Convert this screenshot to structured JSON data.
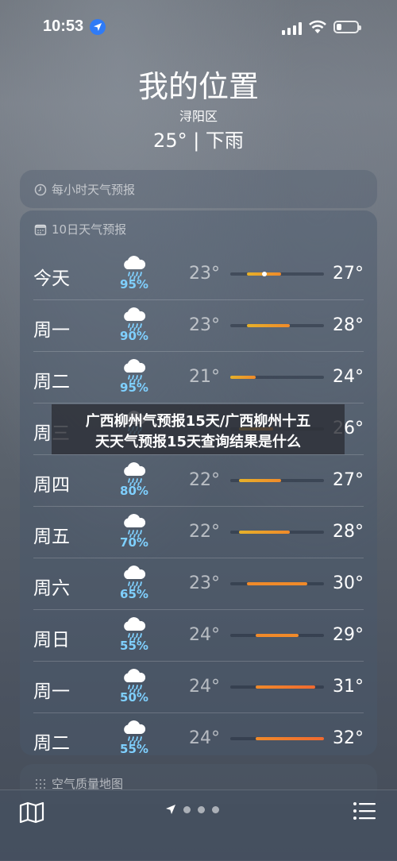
{
  "status_bar": {
    "time": "10:53",
    "icons": [
      "location-arrow-icon",
      "signal-icon",
      "wifi-icon",
      "battery-icon"
    ]
  },
  "header": {
    "title": "我的位置",
    "district": "浔阳区",
    "current": "25° | 下雨"
  },
  "hourly_panel": {
    "label": "每小时天气预报",
    "icon": "clock-icon"
  },
  "daily_panel": {
    "label": "10日天气预报",
    "icon": "calendar-icon",
    "range": [
      21,
      32
    ],
    "days": [
      {
        "day": "今天",
        "icon": "rain-cloud-icon",
        "pop": "95%",
        "low": "23°",
        "high": "27°",
        "lo": 23,
        "hi": 27,
        "current": 25
      },
      {
        "day": "周一",
        "icon": "rain-cloud-icon",
        "pop": "90%",
        "low": "23°",
        "high": "28°",
        "lo": 23,
        "hi": 28
      },
      {
        "day": "周二",
        "icon": "rain-cloud-icon",
        "pop": "95%",
        "low": "21°",
        "high": "24°",
        "lo": 21,
        "hi": 24
      },
      {
        "day": "周三",
        "icon": "rain-cloud-icon",
        "pop": "",
        "low": "",
        "high": "26°",
        "lo": 22,
        "hi": 26
      },
      {
        "day": "周四",
        "icon": "rain-cloud-icon",
        "pop": "80%",
        "low": "22°",
        "high": "27°",
        "lo": 22,
        "hi": 27
      },
      {
        "day": "周五",
        "icon": "rain-cloud-icon",
        "pop": "70%",
        "low": "22°",
        "high": "28°",
        "lo": 22,
        "hi": 28
      },
      {
        "day": "周六",
        "icon": "rain-cloud-icon",
        "pop": "65%",
        "low": "23°",
        "high": "30°",
        "lo": 23,
        "hi": 30
      },
      {
        "day": "周日",
        "icon": "rain-cloud-icon",
        "pop": "55%",
        "low": "24°",
        "high": "29°",
        "lo": 24,
        "hi": 29
      },
      {
        "day": "周一",
        "icon": "rain-cloud-icon",
        "pop": "50%",
        "low": "24°",
        "high": "31°",
        "lo": 24,
        "hi": 31
      },
      {
        "day": "周二",
        "icon": "rain-cloud-icon",
        "pop": "55%",
        "low": "24°",
        "high": "32°",
        "lo": 24,
        "hi": 32
      }
    ]
  },
  "air_quality_panel": {
    "label": "空气质量地图"
  },
  "overlay": {
    "line1": "广西柳州气预报15天/广西柳州十五",
    "line2": "天天气预报15天查询结果是什么"
  },
  "bottom_bar": {
    "icons": [
      "map-icon",
      "location-arrow-icon",
      "list-icon"
    ],
    "pages": 3
  },
  "colors": {
    "cool": "#e6b12a",
    "warm": "#f08a2a",
    "hot": "#f06a30",
    "pop": "#7fd0ff",
    "accent": "#2f7bf6"
  }
}
